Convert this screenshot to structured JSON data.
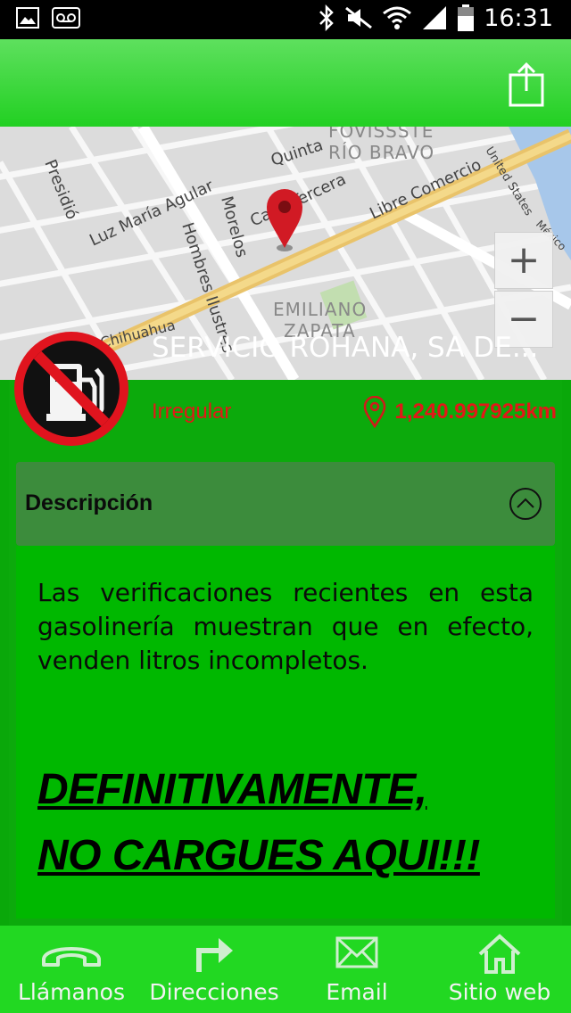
{
  "status_bar": {
    "time": "16:31"
  },
  "map": {
    "labels": {
      "fovissste": "FOVISSSTE",
      "rio_bravo": "RÍO BRAVO",
      "quinta": "Quinta",
      "presidio": "Presidió",
      "luz": "Luz María Agular",
      "morelos": "Morelos",
      "calle": "Calle Tercera",
      "libre": "Libre Comercio",
      "united": "United States",
      "mexico": "México",
      "hombres": "Hombres Ilustres",
      "emiliano": "EMILIANO",
      "zapata": "ZAPATA",
      "chihuahua": "Chihuahua"
    },
    "zoom_in": "+",
    "zoom_out": "−"
  },
  "station": {
    "name": "SERVICIO ROHANA, SA DE...",
    "status": "Irregular",
    "distance": "1,240.997925km"
  },
  "description": {
    "title": "Descripción",
    "text": "Las verificaciones recientes en esta gasolinería muestran que en efecto, venden litros incompletos.",
    "warning_line1": "DEFINITIVAMENTE,",
    "warning_line2": "NO CARGUES AQUI!!!"
  },
  "bottom_nav": [
    {
      "label": "Llámanos",
      "icon": "phone-icon"
    },
    {
      "label": "Direcciones",
      "icon": "directions-icon"
    },
    {
      "label": "Email",
      "icon": "email-icon"
    },
    {
      "label": "Sitio web",
      "icon": "home-icon"
    }
  ],
  "colors": {
    "accent": "#22d822",
    "status_red": "#e21818",
    "content_green": "#0caa0c"
  }
}
